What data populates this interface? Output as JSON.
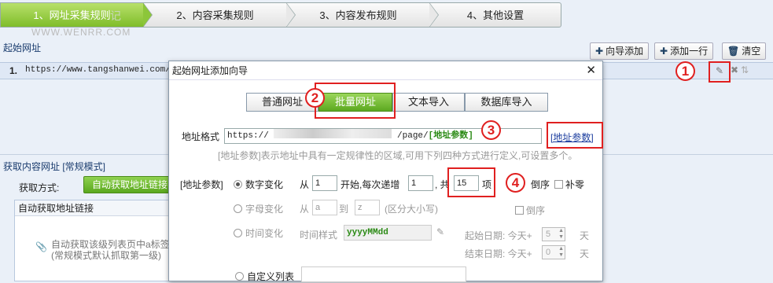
{
  "steps": [
    "1、网址采集规则",
    "2、内容采集规则",
    "3、内容发布规则",
    "4、其他设置"
  ],
  "watermark": "WWW.WENRR.COM",
  "watermark2": "记",
  "section1": {
    "title": "起始网址"
  },
  "toolbar": {
    "wizard_add": "向导添加",
    "add_row": "添加一行",
    "clear": "清空"
  },
  "row": {
    "num": "1.",
    "url": "https://www.tangshanwei.com/yu"
  },
  "marks": {
    "m1": "1",
    "m2": "2",
    "m3": "3",
    "m4": "4"
  },
  "section2": {
    "title": "获取内容网址 [常规模式]",
    "method_label": "获取方式:",
    "method_btn": "自动获取地址链接",
    "panel_title": "自动获取地址链接",
    "panel_text1": "自动获取该级列表页中a标签",
    "panel_text2": "(常规模式默认抓取第一级)"
  },
  "dialog": {
    "title": "起始网址添加向导",
    "tabs": [
      "普通网址",
      "批量网址",
      "文本导入",
      "数据库导入"
    ],
    "format_label": "地址格式",
    "format_value_a": "https://",
    "format_value_b": "/page/",
    "format_value_param": "[地址参数]",
    "param_link": "[地址参数]",
    "hint": "[地址参数]表示地址中具有一定规律性的区域,可用下列四种方式进行定义,可设置多个。",
    "param_label": "[地址参数]",
    "num_label": "数字变化",
    "from": "从",
    "start_val": "1",
    "start_text": "开始,每次递增",
    "step_val": "1",
    "total_text": ", 共",
    "count_val": "15",
    "item_text": "项",
    "reverse": "倒序",
    "pad": "补零",
    "letter_label": "字母变化",
    "letter_from": "a",
    "to": "到",
    "letter_to": "z",
    "case_note": "(区分大小写)",
    "reverse2": "倒序",
    "time_label": "时间变化",
    "time_style_label": "时间样式",
    "time_style": "yyyyMMdd",
    "start_date_label": "起始日期: 今天+",
    "start_date_val": "5",
    "day": "天",
    "end_date_label": "结束日期: 今天+",
    "end_date_val": "0",
    "custom_label": "自定义列表"
  }
}
